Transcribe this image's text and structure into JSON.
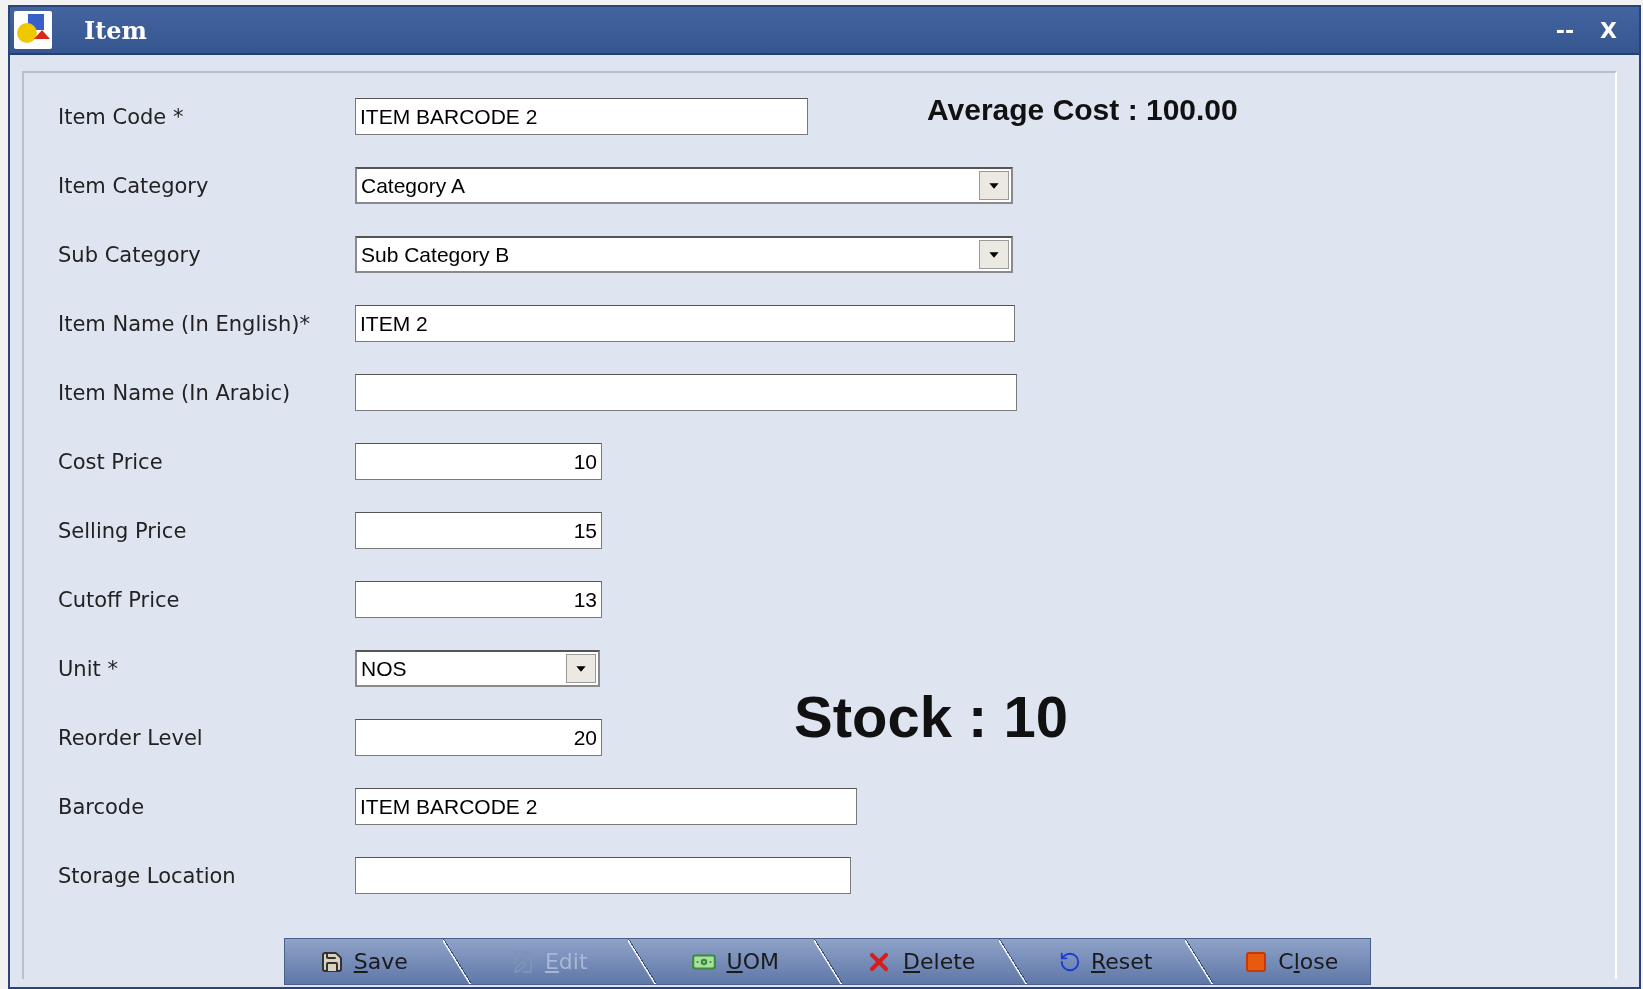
{
  "window": {
    "title": "Item",
    "minimize": "--",
    "close": "X"
  },
  "fields": [
    {
      "label": "Item Code *",
      "kind": "text",
      "value": "ITEM BARCODE 2"
    },
    {
      "label": "Item Category",
      "kind": "select",
      "value": "Category A"
    },
    {
      "label": "Sub Category",
      "kind": "select",
      "value": "Sub Category B"
    },
    {
      "label": "Item Name (In English)*",
      "kind": "text",
      "value": "ITEM 2"
    },
    {
      "label": "Item Name (In Arabic)",
      "kind": "text"
    },
    {
      "label": "Cost Price",
      "kind": "number",
      "value": "10"
    },
    {
      "label": "Selling Price",
      "kind": "number",
      "value": "15"
    },
    {
      "label": "Cutoff Price",
      "kind": "number",
      "value": "13"
    },
    {
      "label": "Unit *",
      "kind": "select",
      "value": "NOS"
    },
    {
      "label": "Reorder Level",
      "kind": "number",
      "value": "20"
    },
    {
      "label": "Barcode",
      "kind": "text",
      "value": "ITEM BARCODE 2"
    },
    {
      "label": "Storage Location",
      "kind": "text"
    }
  ],
  "average_cost": "Average Cost : 100.00",
  "stock": "Stock : 10",
  "buttons": [
    {
      "label": "Save",
      "disabled": false
    },
    {
      "label": "Edit",
      "disabled": true
    },
    {
      "label": "UOM",
      "disabled": false
    },
    {
      "label": "Delete",
      "disabled": false
    },
    {
      "label": "Reset",
      "disabled": false
    },
    {
      "label": "Close",
      "disabled": false
    }
  ]
}
